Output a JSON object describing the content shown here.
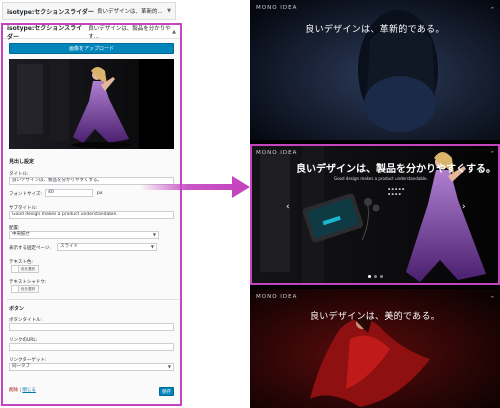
{
  "collapsed_section": {
    "type_label": "isotype:セクションスライダー",
    "title": "良いデザインは、革新的..."
  },
  "panel": {
    "type_label": "isotype:セクションスライダー",
    "title": "良いデザインは、製品を分かりやす...",
    "upload_button": "画像をアップロード",
    "heading_settings": "見出し設定",
    "title_label": "タイトル:",
    "title_value": "良いデザインは、製品を分かりやすくする。",
    "font_size_label": "フォントサイズ:",
    "font_size_value": "40",
    "font_size_unit": "px",
    "subtitle_label": "サブタイトル:",
    "subtitle_value": "Good design makes a product understandable.",
    "align_label": "配置:",
    "align_value": "中央揃せ",
    "display_page_label": "表示する固定ページ:",
    "display_page_value": "スライド",
    "text_color_label": "テキスト色:",
    "text_shadow_label": "テキストシャドウ:",
    "color_button": "色を選択",
    "button_heading": "ボタン",
    "button_title_label": "ボタンタイトル:",
    "link_url_label": "リンクのURL:",
    "link_target_label": "リンクターゲット:",
    "link_target_value": "同一タブ",
    "delete_link": "削除",
    "close_link": "閉じる",
    "save_button": "保存"
  },
  "preview": {
    "slide1": {
      "logo": "MONO IDEA",
      "headline": "良いデザインは、革新的である。"
    },
    "slide2": {
      "logo": "MONO IDEA",
      "headline": "良いデザインは、製品を分かりやすくする。",
      "subtitle": "Good design makes a product understandable."
    },
    "slide3": {
      "logo": "MONO IDEA",
      "headline": "良いデザインは、美的である。"
    }
  },
  "colors": {
    "highlight": "#c545c0",
    "wp_blue": "#0085ba"
  }
}
